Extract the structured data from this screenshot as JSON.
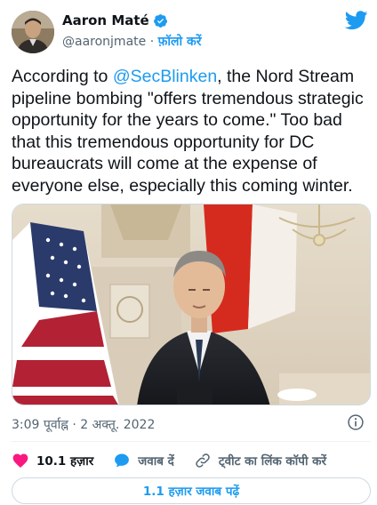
{
  "author": {
    "name": "Aaron Maté",
    "handle": "@aaronjmate",
    "separator": "·",
    "follow_label": "फ़ॉलो करें",
    "verified_icon": "verified-badge-icon",
    "avatar_icon": "profile-avatar"
  },
  "brand": {
    "icon": "twitter-bird-icon",
    "color": "#1d9bf0"
  },
  "tweet": {
    "text_before": "According to ",
    "mention": "@SecBlinken",
    "text_after": ", the Nord Stream pipeline bombing \"offers tremendous strategic opportunity for the years to come.\" Too bad that this tremendous opportunity for DC bureaucrats will come at the expense of everyone else, especially this coming winter."
  },
  "media": {
    "description_icon": "video-thumbnail"
  },
  "meta": {
    "timestamp": "3:09 पूर्वाह्न · 2 अक्तू. 2022",
    "info_icon": "info-icon"
  },
  "actions": {
    "like_count": "10.1 हज़ार",
    "reply_label": "जवाब दें",
    "copy_link_label": "ट्वीट का लिंक कॉपी करें"
  },
  "footer": {
    "read_replies_label": "1.1 हज़ार जवाब पढ़ें"
  },
  "colors": {
    "like": "#f91880",
    "reply": "#1d9bf0",
    "text_primary": "#0f1419",
    "text_secondary": "#536471"
  }
}
